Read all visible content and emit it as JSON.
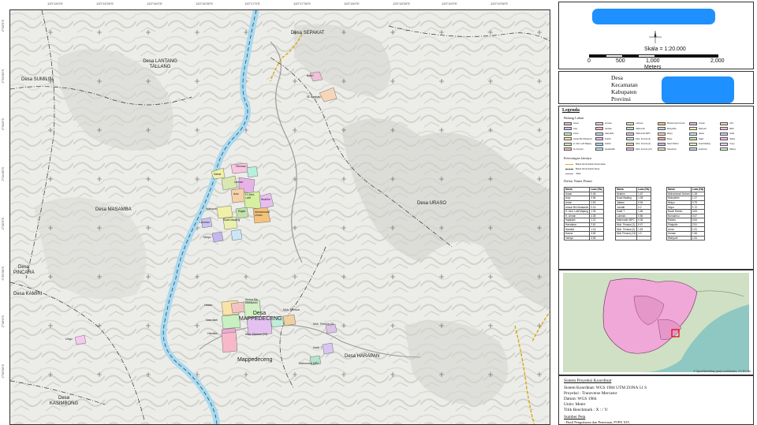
{
  "map": {
    "grid_top_labels": [
      "120°15'0\"E",
      "120°15'30\"E",
      "120°16'0\"E",
      "120°16'30\"E",
      "120°17'0\"E",
      "120°17'30\"E",
      "120°18'0\"E",
      "120°18'30\"E",
      "120°19'0\"E",
      "120°19'30\"E"
    ],
    "grid_left_labels": [
      "2°33'0\"S",
      "2°33'30\"S",
      "2°34'0\"S",
      "2°34'30\"S",
      "2°35'0\"S",
      "2°35'30\"S",
      "2°36'0\"S",
      "2°36'30\"S"
    ],
    "places": {
      "sepakat": "Desa SEPAKAT",
      "lantang_tallang": "Desa LANTANG TALLANG",
      "sumilin": "Desa SUMILIN",
      "masamba": "Desa MASAMBA",
      "uraso": "Desa URASO",
      "pincara": "Desa PINCARA",
      "kamiri": "Desa KAMIRI",
      "mappedeceng_desa": "Desa MAPPEDECENG",
      "mappedeceng": "Mappedeceng",
      "harapan": "Desa HARAPAN",
      "kasimbong": "Desa KASIMBONG"
    },
    "plot_labels": {
      "bahri": "Bahri",
      "st_aminah": "St. Aminah",
      "herman": "Herman",
      "sahar": "Sahar",
      "aziz": "Aziz",
      "abd_latif": "H. Abd. Latif",
      "ibrahim": "Ibrahim",
      "wahyudi": "Wahyudi",
      "muh_uman": "Muhammad Uman",
      "suad_mading": "Suad Mading",
      "usman": "Usman",
      "lukman": "Lukman",
      "mulyo": "Mulyo",
      "rajab": "Rajab",
      "hasan": "Hasan",
      "nasrullah": "Nasrullah",
      "anwar": "Anwar Bin Mustamin",
      "muh_fensza": "Muh. Fensza",
      "muh_fensza_13": "Muh. Fensza (13)",
      "muh_fensza_2": "Muh. Fensza (2)",
      "kadir": "Kadir T",
      "mahmudin": "Mahmudin MPC",
      "hamida": "Hamida",
      "ungu": "Ungu"
    }
  },
  "scale_panel": {
    "scale_text": "Skala = 1:20.000",
    "ticks": [
      "0",
      "500",
      "1,000",
      "2,000"
    ],
    "unit": "Meters"
  },
  "admin_panel": {
    "labels": [
      "Desa",
      "Kecamatan",
      "Kabupaten",
      "Provinsi"
    ]
  },
  "legend": {
    "title": "Legenda",
    "bidang_lahan": "Bidang Lahan",
    "keterangan": "Keterangan lainnya",
    "batas_kecamatan": "Batas Administrasi Kecamatan",
    "batas_desa": "Batas Administrasi Desa",
    "jalan": "Jalan",
    "daftar": "Daftar Nama Petani",
    "items": [
      {
        "name": "Ansar",
        "color": "#f2b8b8"
      },
      {
        "name": "Herman",
        "color": "#f7c6e0"
      },
      {
        "name": "Lukman",
        "color": "#d9e8b0"
      },
      {
        "name": "Muhammad Usman",
        "color": "#f4c27a"
      },
      {
        "name": "Usman",
        "color": "#e7b3e7"
      },
      {
        "name": "Aziz",
        "color": "#f7d1a8"
      },
      {
        "name": "Anjo",
        "color": "#c9c3f0"
      },
      {
        "name": "Hamida",
        "color": "#f7b9c9"
      },
      {
        "name": "Mahmudin",
        "color": "#b6e3cb"
      },
      {
        "name": "Muhyiddin",
        "color": "#c6d3f5"
      },
      {
        "name": "Wahyudi",
        "color": "#f0f0a8"
      },
      {
        "name": "Bahri",
        "color": "#f0c0d8"
      },
      {
        "name": "Anton",
        "color": "#c9f0c0"
      },
      {
        "name": "Haeruddin",
        "color": "#b9d9f2"
      },
      {
        "name": "Mahmudin MPC",
        "color": "#e3c1f0"
      },
      {
        "name": "Mulyo",
        "color": "#f5d6b8"
      },
      {
        "name": "Hasan",
        "color": "#cbe6f5"
      },
      {
        "name": "Kadir",
        "color": "#d8c6f2"
      },
      {
        "name": "Anwar Bin Mustamin",
        "color": "#fbe2a6"
      },
      {
        "name": "Ibrahim",
        "color": "#e8bdf2"
      },
      {
        "name": "Muh. Fensza (1)",
        "color": "#c0ecd9"
      },
      {
        "name": "Mujur",
        "color": "#f3a7a7"
      },
      {
        "name": "Rajab",
        "color": "#bfe3a9"
      },
      {
        "name": "Sahar",
        "color": "#f5bbe3"
      },
      {
        "name": "H. Abd. Latif Majang",
        "color": "#d4f0a0"
      },
      {
        "name": "Ibrahim",
        "color": "#a9d3f0"
      },
      {
        "name": "Muh. Fensza (2)",
        "color": "#f0d0a0"
      },
      {
        "name": "Nawir Rahim",
        "color": "#c3b7ee"
      },
      {
        "name": "Suad Mading",
        "color": "#e9f0b0"
      },
      {
        "name": "Ungu",
        "color": "#f7c9f0"
      },
      {
        "name": "St. Aminah",
        "color": "#f2c3c3"
      },
      {
        "name": "Jamaluddin",
        "color": "#b7f0dc"
      },
      {
        "name": "Muh. Fensza (13)",
        "color": "#dcc2ea"
      },
      {
        "name": "Nursamsu",
        "color": "#f0e0b0"
      },
      {
        "name": "Sudirman",
        "color": "#bcd8f5"
      },
      {
        "name": "Wahyu",
        "color": "#d2f0c4"
      }
    ],
    "owners_columns": [
      "Nama",
      "Luas (Ha)"
    ],
    "owners": [
      [
        [
          "Ansar",
          "0.46"
        ],
        [
          "Anjo",
          "0.56"
        ],
        [
          "Anton",
          "1.53"
        ],
        [
          "Anwar Bin Mustamin",
          "0.16"
        ],
        [
          "H. Abd. Latif Majang",
          "1.35"
        ],
        [
          "H. Arman",
          "4.38"
        ],
        [
          "Hajarijah",
          "1.22"
        ],
        [
          "Hamdana",
          "2.61"
        ],
        [
          "Hamida",
          "1.16"
        ],
        [
          "Hasna",
          "3.65"
        ],
        [
          "Insinyo",
          "3.55"
        ]
      ],
      [
        [
          "Ibrahim",
          "1.67"
        ],
        [
          "Suad Mading",
          "1.28"
        ],
        [
          "Jafaan",
          "0.94"
        ],
        [
          "Jumiati",
          "0.2"
        ],
        [
          "Kadir T",
          "1.66"
        ],
        [
          "Lukman",
          "0.56"
        ],
        [
          "Mahmudin MPC",
          "0.05"
        ],
        [
          "Muh. Fensza (1)",
          "0.47"
        ],
        [
          "Muh. Fensza (2)",
          "1.63"
        ],
        [
          "Muh Fensza (13)",
          "1.3"
        ],
        [
          "",
          ""
        ]
      ],
      [
        [
          "Muhammad Usman",
          "1.08"
        ],
        [
          "Muhyiddin",
          "1.27"
        ],
        [
          "Mulyo",
          "0.75"
        ],
        [
          "Mujur",
          "1.72"
        ],
        [
          "Nawir Rahim",
          "3.83"
        ],
        [
          "Nursamsu",
          "0.67"
        ],
        [
          "Rabinu",
          "0.64"
        ],
        [
          "Sirajudin",
          "2.51"
        ],
        [
          "Umar",
          "1.91"
        ],
        [
          "Usman",
          "1.66"
        ],
        [
          "Wahyudi",
          "1.54"
        ]
      ]
    ]
  },
  "inset": {
    "credit": "© OpenStreetMap (and) contributors, CC-BY-SA"
  },
  "coord_panel": {
    "title": "Sistem Proyeksi Koordinat",
    "lines": [
      "Sistem Koordinat: WGS 1984 UTM ZONA 51 S",
      "Proyeksi : Transverse Mercator",
      "Datum: WGS 1984",
      "Units: Meter",
      "Titik Benchmark : X :       / Y:"
    ],
    "source_title": "Sumber Peta",
    "source_line": "- Hasil Pengukuran dan Pemetaan, PTPN XIV,"
  },
  "colors": {
    "river": "#7fc8e6",
    "road": "#d9a400",
    "boundary": "#222222",
    "relief": "#d6d6d2",
    "inset_pink": "#f0a8d8"
  }
}
